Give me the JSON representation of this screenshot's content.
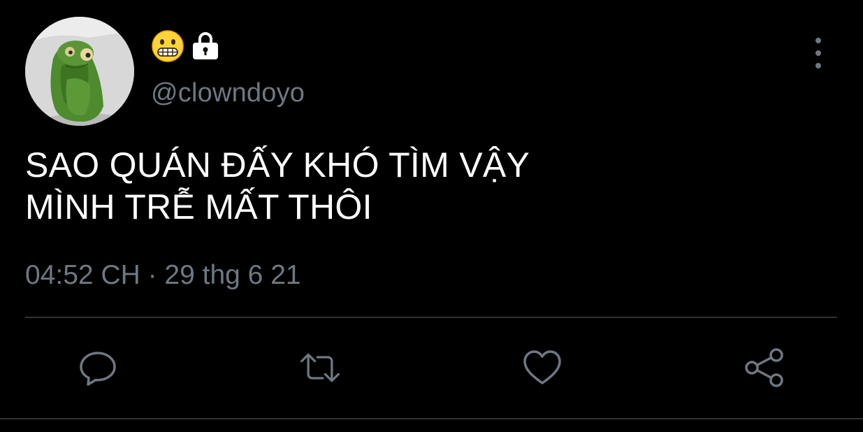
{
  "author": {
    "handle": "@clowndoyo",
    "name_icons": [
      "grimacing-face-emoji",
      "lock-icon"
    ]
  },
  "tweet": {
    "lines": [
      "SAO QUÁN ĐẤY KHÓ TÌM VẬY",
      "MÌNH TRỄ MẤT THÔI"
    ],
    "timestamp": "04:52 CH · 29 thg 6 21"
  },
  "actions": [
    "reply-icon",
    "retweet-icon",
    "like-icon",
    "share-icon"
  ],
  "colors": {
    "background": "#000000",
    "text": "#ffffff",
    "secondary": "#6e7882",
    "divider": "#2f3336"
  }
}
